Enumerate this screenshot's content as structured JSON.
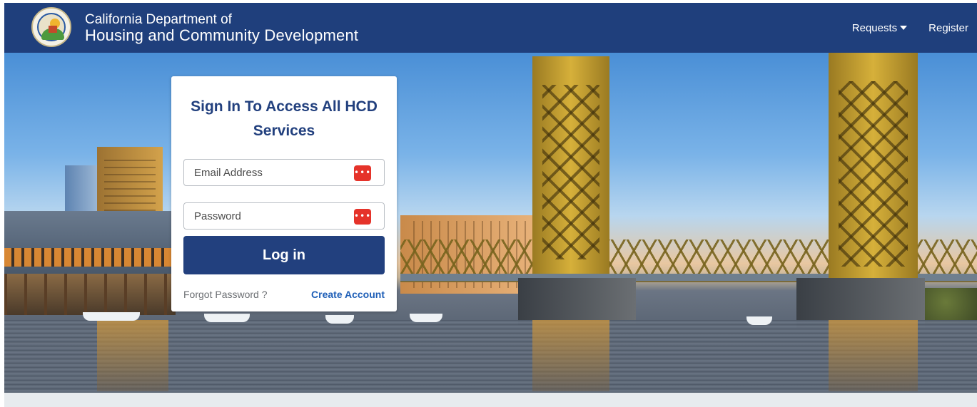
{
  "header": {
    "title_line1": "California Department of",
    "title_line2": "Housing and Community Development",
    "logo_icon": "california-hcd-seal-logo",
    "nav": {
      "requests_label": "Requests",
      "register_label": "Register"
    },
    "background_color": "#1f3f7c"
  },
  "login": {
    "title": "Sign In To Access All HCD Services",
    "email_placeholder": "Email Address",
    "password_placeholder": "Password",
    "password_manager_icon": "password-manager-icon",
    "login_button": "Log in",
    "forgot_password": "Forgot Password ?",
    "create_account": "Create Account",
    "accent_color": "#22407e",
    "link_color": "#1f5fb7"
  },
  "hero": {
    "scene": "tower-bridge-river-background"
  }
}
